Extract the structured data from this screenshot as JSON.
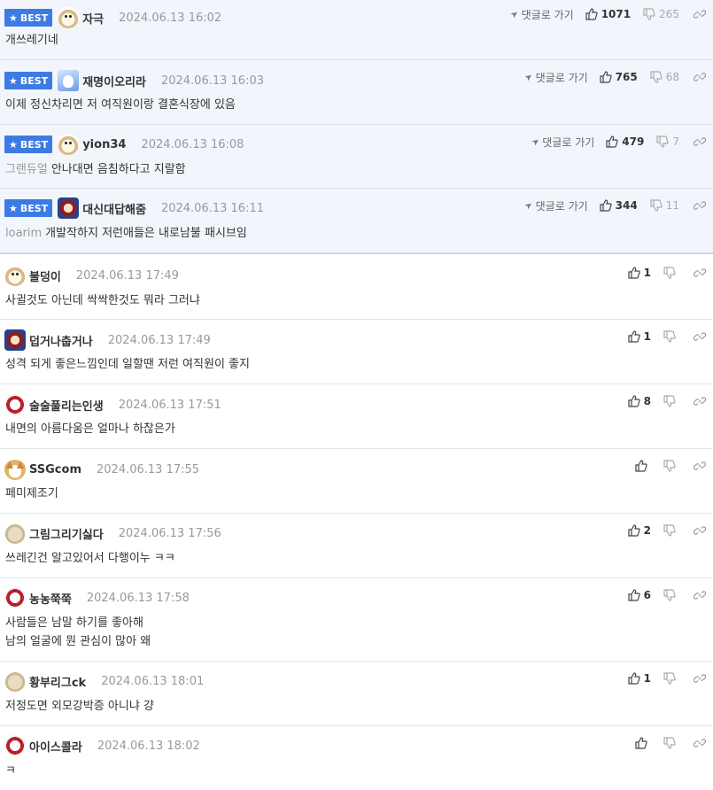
{
  "labels": {
    "best": "BEST",
    "goto": "댓글로 가기"
  },
  "colors": {
    "best_badge": "#3c7be3",
    "best_row_bg": "#f2f5fb",
    "date": "#999999"
  },
  "best_comments": [
    {
      "avatar": "dog-icon",
      "nick": "자극",
      "date": "2024.06.13 16:02",
      "prefix": "",
      "text": "개쓰레기네",
      "up": "1071",
      "down": "265"
    },
    {
      "avatar": "blue-character-icon",
      "nick": "재명이오리라",
      "date": "2024.06.13 16:03",
      "prefix": "",
      "text": "이제 정신차리면 저 여직원이랑 결혼식장에 있음",
      "up": "765",
      "down": "68"
    },
    {
      "avatar": "dog-icon",
      "nick": "yion34",
      "date": "2024.06.13 16:08",
      "prefix": "그랜듀얼",
      "text": "안나대면 음침하다고 지랄함",
      "up": "479",
      "down": "7"
    },
    {
      "avatar": "lion-icon",
      "nick": "대신대답해줌",
      "date": "2024.06.13 16:11",
      "prefix": "loarim",
      "text": "개발작하지 저런애들은 내로남불 패시브임",
      "up": "344",
      "down": "11"
    }
  ],
  "comments": [
    {
      "avatar": "dog-icon",
      "nick": "불덩이",
      "date": "2024.06.13 17:49",
      "lines": [
        "사귈것도 아닌데 싹싹한것도 뭐라 그러냐"
      ],
      "up": "1",
      "down": ""
    },
    {
      "avatar": "lion-icon",
      "nick": "덥거나춥거나",
      "date": "2024.06.13 17:49",
      "lines": [
        "성격 되게 좋은느낌인데 일할땐 저런 여직원이 좋지"
      ],
      "up": "1",
      "down": ""
    },
    {
      "avatar": "mask-icon",
      "nick": "술술풀리는인생",
      "date": "2024.06.13 17:51",
      "lines": [
        "내면의 아름다움은 얼마나 하찮은가"
      ],
      "up": "8",
      "down": ""
    },
    {
      "avatar": "fox-icon",
      "nick": "SSGcom",
      "date": "2024.06.13 17:55",
      "lines": [
        "페미제조기"
      ],
      "up": "",
      "down": ""
    },
    {
      "avatar": "beige-blob-icon",
      "nick": "그림그리기싫다",
      "date": "2024.06.13 17:56",
      "lines": [
        "쓰레긴건 알고있어서 다행이누 ㅋㅋ"
      ],
      "up": "2",
      "down": ""
    },
    {
      "avatar": "mask-icon",
      "nick": "농농쭉쭉",
      "date": "2024.06.13 17:58",
      "lines": [
        "사람들은 남말 하기를 좋아해",
        "남의 얼굴에 뭔 관심이 많아 왜"
      ],
      "up": "6",
      "down": ""
    },
    {
      "avatar": "beige-blob-icon",
      "nick": "황부리그ck",
      "date": "2024.06.13 18:01",
      "lines": [
        "저정도면 외모강박증 아니냐 걍"
      ],
      "up": "1",
      "down": ""
    },
    {
      "avatar": "mask-icon",
      "nick": "아이스콜라",
      "date": "2024.06.13 18:02",
      "lines": [
        "ㅋ"
      ],
      "up": "",
      "down": ""
    }
  ]
}
